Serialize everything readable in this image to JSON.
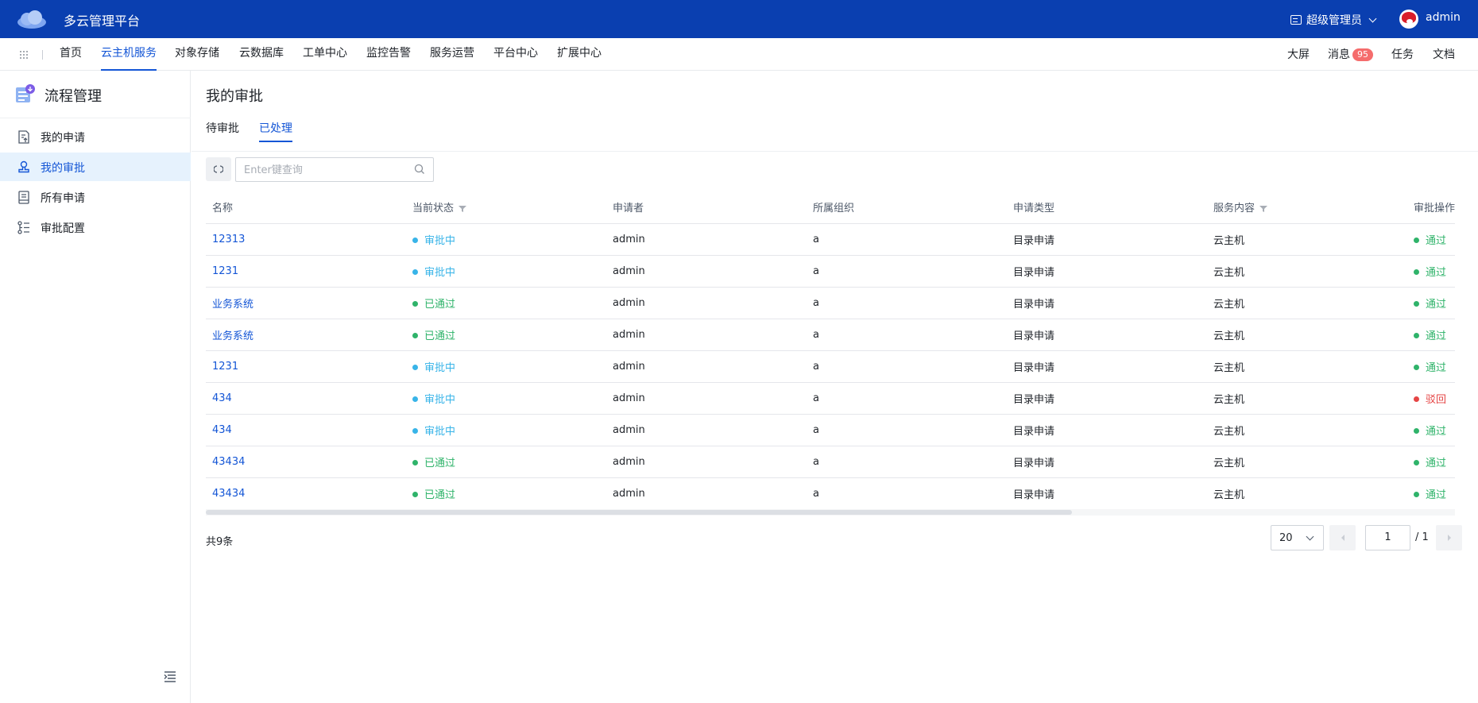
{
  "app": {
    "title": "多云管理平台"
  },
  "topbar": {
    "role": "超级管理员",
    "user": "admin"
  },
  "nav": {
    "items": [
      "首页",
      "云主机服务",
      "对象存储",
      "云数据库",
      "工单中心",
      "监控告警",
      "服务运营",
      "平台中心",
      "扩展中心"
    ],
    "active": "云主机服务",
    "right": {
      "screen": "大屏",
      "messages": "消息",
      "message_count": "95",
      "tasks": "任务",
      "docs": "文档"
    }
  },
  "sidebar": {
    "title": "流程管理",
    "items": [
      {
        "label": "我的申请",
        "icon": "document-upload-icon"
      },
      {
        "label": "我的审批",
        "icon": "stamp-icon"
      },
      {
        "label": "所有申请",
        "icon": "document-list-icon"
      },
      {
        "label": "审批配置",
        "icon": "list-settings-icon"
      }
    ],
    "active": "我的审批"
  },
  "main": {
    "title": "我的审批",
    "tabs": [
      "待审批",
      "已处理"
    ],
    "active_tab": "已处理",
    "search": {
      "placeholder": "Enter键查询"
    },
    "table": {
      "columns": [
        "名称",
        "当前状态",
        "申请者",
        "所属组织",
        "申请类型",
        "服务内容",
        "审批操作"
      ],
      "rows": [
        {
          "name": "12313",
          "status": "审批中",
          "status_type": "pending",
          "applicant": "admin",
          "org": "a",
          "type": "目录申请",
          "service": "云主机",
          "action": "通过",
          "action_type": "pass"
        },
        {
          "name": "1231",
          "status": "审批中",
          "status_type": "pending",
          "applicant": "admin",
          "org": "a",
          "type": "目录申请",
          "service": "云主机",
          "action": "通过",
          "action_type": "pass"
        },
        {
          "name": "业务系统",
          "status": "已通过",
          "status_type": "passed",
          "applicant": "admin",
          "org": "a",
          "type": "目录申请",
          "service": "云主机",
          "action": "通过",
          "action_type": "pass"
        },
        {
          "name": "业务系统",
          "status": "已通过",
          "status_type": "passed",
          "applicant": "admin",
          "org": "a",
          "type": "目录申请",
          "service": "云主机",
          "action": "通过",
          "action_type": "pass"
        },
        {
          "name": "1231",
          "status": "审批中",
          "status_type": "pending",
          "applicant": "admin",
          "org": "a",
          "type": "目录申请",
          "service": "云主机",
          "action": "通过",
          "action_type": "pass"
        },
        {
          "name": "434",
          "status": "审批中",
          "status_type": "pending",
          "applicant": "admin",
          "org": "a",
          "type": "目录申请",
          "service": "云主机",
          "action": "驳回",
          "action_type": "reject"
        },
        {
          "name": "434",
          "status": "审批中",
          "status_type": "pending",
          "applicant": "admin",
          "org": "a",
          "type": "目录申请",
          "service": "云主机",
          "action": "通过",
          "action_type": "pass"
        },
        {
          "name": "43434",
          "status": "已通过",
          "status_type": "passed",
          "applicant": "admin",
          "org": "a",
          "type": "目录申请",
          "service": "云主机",
          "action": "通过",
          "action_type": "pass"
        },
        {
          "name": "43434",
          "status": "已通过",
          "status_type": "passed",
          "applicant": "admin",
          "org": "a",
          "type": "目录申请",
          "service": "云主机",
          "action": "通过",
          "action_type": "pass"
        }
      ]
    },
    "pagination": {
      "total": "共9条",
      "page_size": "20",
      "page": "1",
      "of_pages": "/ 1"
    }
  },
  "colors": {
    "topbar": "#0a3fb0",
    "accent": "#1456d6",
    "pending": "#38b4e8",
    "passed": "#2fb36a",
    "reject": "#e54545"
  }
}
